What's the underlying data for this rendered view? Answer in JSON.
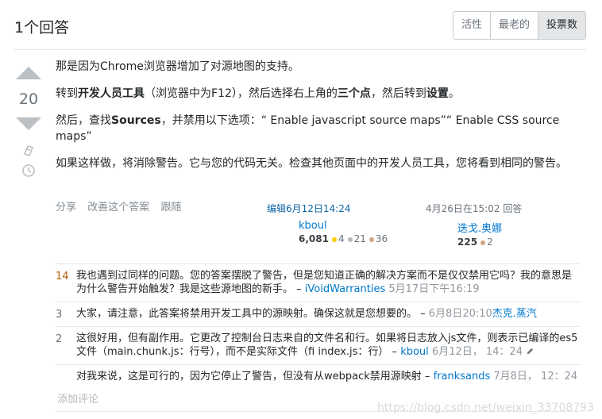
{
  "header": {
    "answers_count": "1个回答",
    "sort_tabs": [
      "活性",
      "最老的",
      "投票数"
    ],
    "active_tab": "投票数"
  },
  "vote": {
    "count": "20"
  },
  "post": {
    "p1": "那是因为Chrome浏览器增加了对源地图的支持。",
    "p2": {
      "a": "转到",
      "b1": "开发人员工具",
      "c": "（浏览器中为F12），然后选择右上角的",
      "b2": "三个点",
      "d": "，然后转到",
      "b3": "设置",
      "e": "。"
    },
    "p3": {
      "a": "然后，查找",
      "b": "Sources",
      "c": "，并禁用以下选项：“ Enable javascript source maps”“ Enable CSS source maps”"
    },
    "p4": "如果这样做，将消除警告。它与您的代码无关。检查其他页面中的开发人员工具，您将看到相同的警告。"
  },
  "actions": [
    "分享",
    "改善这个答案",
    "跟随"
  ],
  "editor": {
    "label": "编辑6月12日14:24",
    "name": "kboul",
    "rep": "6,081",
    "gold": "4",
    "silver": "21",
    "bronze": "36"
  },
  "author": {
    "label": "4月26日在15:02 回答",
    "name": "迭戈.奥娜",
    "rep": "225",
    "bronze": "2"
  },
  "comments": [
    {
      "score": "14",
      "hot": true,
      "text": "我也遇到过同样的问题。您的答案摆脱了警告，但是您知道正确的解决方案而不是仅仅禁用它吗？我的意思是为什么警告开始触发？我是这些源地图的新手。 –",
      "user": "iVoidWarranties",
      "time": "5月17日下午16:19"
    },
    {
      "score": "3",
      "hot": false,
      "text": "大家，请注意，此答案将禁用开发工具中的源映射。确保这就是您想要的。 –",
      "user": "",
      "time": "6月8日20:10",
      "user2": "杰克.蒸汽"
    },
    {
      "score": "2",
      "hot": false,
      "text": "这很好用，但有副作用。它更改了控制台日志来自的文件名和行。如果将日志放入js文件，则表示已编译的es5文件（main.chunk.js：行号），而不是实际文件（fi index.js：行） –",
      "user": "kboul",
      "time": "6月12日， 14：24"
    },
    {
      "score": "",
      "hot": false,
      "text": "对我来说，这是可行的，因为它停止了警告，但没有从webpack禁用源映射 –",
      "user": "franksands",
      "time": "7月8日， 12：24"
    }
  ],
  "add_comment": "添加评论",
  "watermark": "https://blog.csdn.net/weixin_33708793"
}
